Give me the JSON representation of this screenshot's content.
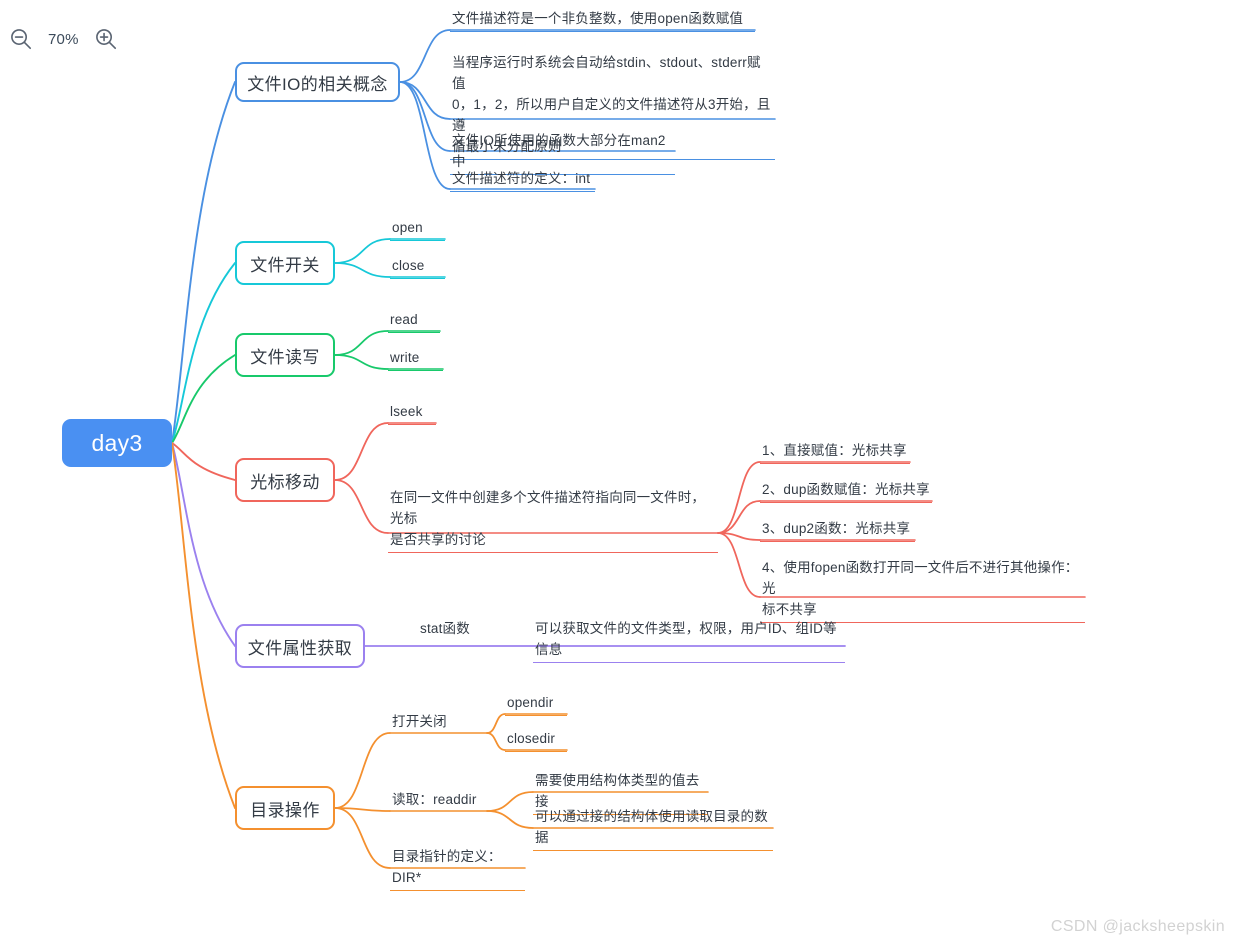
{
  "toolbar": {
    "zoom_out_icon": "zoom-out-magnifier-icon",
    "zoom_level": "70%",
    "zoom_in_icon": "zoom-in-magnifier-icon"
  },
  "watermark": "CSDN @jacksheepskin",
  "colors": {
    "root_fill": "#4a90f2",
    "root_text": "#ffffff",
    "branch_blue": "#4a90e2",
    "branch_cyan": "#16c8d8",
    "branch_green": "#18c96b",
    "branch_red": "#f0665c",
    "branch_purple": "#9b81ef",
    "branch_orange": "#f4902f",
    "text": "#333b45",
    "canvas": "#ffffff",
    "watermark": "#d2d2d2"
  },
  "mindmap": {
    "root": {
      "label": "day3"
    },
    "branches": [
      {
        "label": "文件IO的相关概念",
        "color": "#4a90e2",
        "children": [
          {
            "label": "文件描述符是一个非负整数，使用open函数赋值"
          },
          {
            "label": "当程序运行时系统会自动给stdin、stdout、stderr赋值\n0，1，2，所以用户自定义的文件描述符从3开始，且遵\n循最小未分配原则"
          },
          {
            "label": "文件IO所使用的函数大部分在man2中"
          },
          {
            "label": "文件描述符的定义：int"
          }
        ]
      },
      {
        "label": "文件开关",
        "color": "#16c8d8",
        "children": [
          {
            "label": "open"
          },
          {
            "label": "close"
          }
        ]
      },
      {
        "label": "文件读写",
        "color": "#18c96b",
        "children": [
          {
            "label": "read"
          },
          {
            "label": "write"
          }
        ]
      },
      {
        "label": "光标移动",
        "color": "#f0665c",
        "children": [
          {
            "label": "lseek"
          },
          {
            "label": "在同一文件中创建多个文件描述符指向同一文件时，光标\n是否共享的讨论",
            "children": [
              {
                "label": "1、直接赋值：光标共享"
              },
              {
                "label": "2、dup函数赋值：光标共享"
              },
              {
                "label": "3、dup2函数：光标共享"
              },
              {
                "label": "4、使用fopen函数打开同一文件后不进行其他操作：光\n标不共享"
              }
            ]
          }
        ]
      },
      {
        "label": "文件属性获取",
        "color": "#9b81ef",
        "children": [
          {
            "label": "stat函数",
            "children": [
              {
                "label": "可以获取文件的文件类型，权限，用户ID、组ID等信息"
              }
            ]
          }
        ]
      },
      {
        "label": "目录操作",
        "color": "#f4902f",
        "children": [
          {
            "label": "打开关闭",
            "children": [
              {
                "label": "opendir"
              },
              {
                "label": "closedir"
              }
            ]
          },
          {
            "label": "读取：readdir",
            "children": [
              {
                "label": "需要使用结构体类型的值去接"
              },
              {
                "label": "可以通过接的结构体使用读取目录的数据"
              }
            ]
          },
          {
            "label": "目录指针的定义：DIR*"
          }
        ]
      }
    ]
  }
}
